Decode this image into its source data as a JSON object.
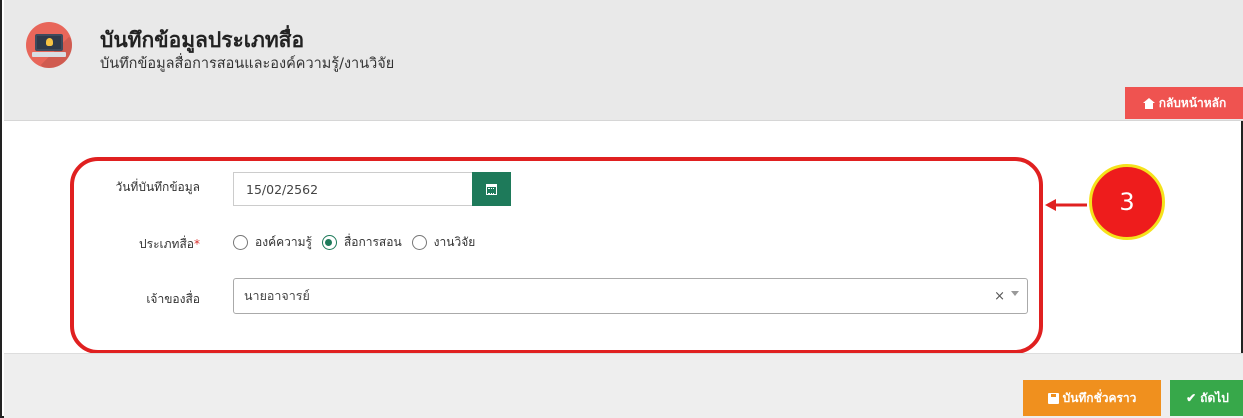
{
  "header": {
    "title": "บันทึกข้อมูลประเภทสื่อ",
    "subtitle": "บันทึกข้อมูลสื่อการสอนและองค์ความรู้/งานวิจัย",
    "home_button": "กลับหน้าหลัก"
  },
  "form": {
    "date_label": "วันที่บันทึกข้อมูล",
    "date_value": "15/02/2562",
    "type_label": "ประเภทสื่อ",
    "type_required_mark": "*",
    "type_options": [
      {
        "label": "องค์ความรู้",
        "checked": false
      },
      {
        "label": "สื่อการสอน",
        "checked": true
      },
      {
        "label": "งานวิจัย",
        "checked": false
      }
    ],
    "owner_label": "เจ้าของสื่อ",
    "owner_value": "นายอาจารย์",
    "owner_clear": "×"
  },
  "footer": {
    "save_draft_button": "บันทึกชั่วคราว",
    "next_button": "ถัดไป",
    "next_check": "✔"
  },
  "annotation": {
    "step_number": "3"
  },
  "colors": {
    "accent_green": "#1e7a5a",
    "home_red": "#ef5350",
    "draft_orange": "#f0901e",
    "next_green": "#37a84a",
    "highlight_red": "#e02020"
  },
  "icons": [
    "laptop-bulb-icon",
    "home-icon",
    "calendar-icon",
    "chevron-down-icon",
    "save-disk-icon",
    "check-icon"
  ]
}
